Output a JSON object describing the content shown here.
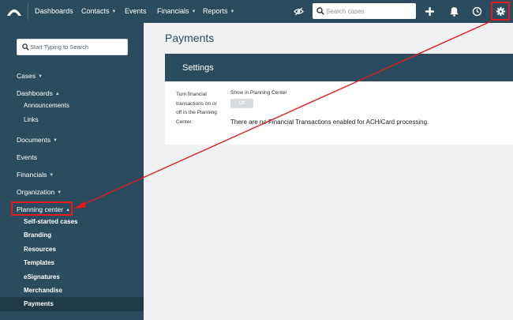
{
  "topbar": {
    "nav": [
      {
        "label": "Dashboards",
        "caret": false
      },
      {
        "label": "Contacts",
        "caret": true
      },
      {
        "label": "Events",
        "caret": false
      },
      {
        "label": "Financials",
        "caret": true
      },
      {
        "label": "Reports",
        "caret": true
      }
    ],
    "search_placeholder": "Search cases",
    "icons": [
      "logo-icon",
      "eye-icon",
      "search-icon",
      "plus-icon",
      "bell-icon",
      "clock-icon",
      "gear-icon"
    ]
  },
  "sidebar": {
    "search_placeholder": "Start Typing to Search",
    "items": [
      {
        "label": "Cases",
        "caret": "down"
      },
      {
        "label": "Dashboards",
        "caret": "up"
      },
      {
        "label": "Announcements"
      },
      {
        "label": "Links"
      },
      {
        "label": "Documents",
        "caret": "down"
      },
      {
        "label": "Events"
      },
      {
        "label": "Financials",
        "caret": "down"
      },
      {
        "label": "Organization",
        "caret": "down"
      },
      {
        "label": "Planning center",
        "caret": "up"
      },
      {
        "label": "Self-started cases"
      },
      {
        "label": "Branding"
      },
      {
        "label": "Resources"
      },
      {
        "label": "Templates"
      },
      {
        "label": "eSignatures"
      },
      {
        "label": "Merchandise"
      },
      {
        "label": "Payments"
      }
    ],
    "active": "Payments"
  },
  "main": {
    "title": "Payments",
    "card_title": "Settings",
    "help_text": "Turn financial transactions on or off in the Planning Center.",
    "show_label": "Show in Planning Center",
    "toggle_label": "Off",
    "toggle_state": "off",
    "info": "There are no Financial Transactions enabled for ACH/Card processing."
  },
  "colors": {
    "navy": "#2b4c5e",
    "active_bg": "#1f3a48",
    "page_bg": "#f0f1f2",
    "highlight": "#e31b1b"
  }
}
